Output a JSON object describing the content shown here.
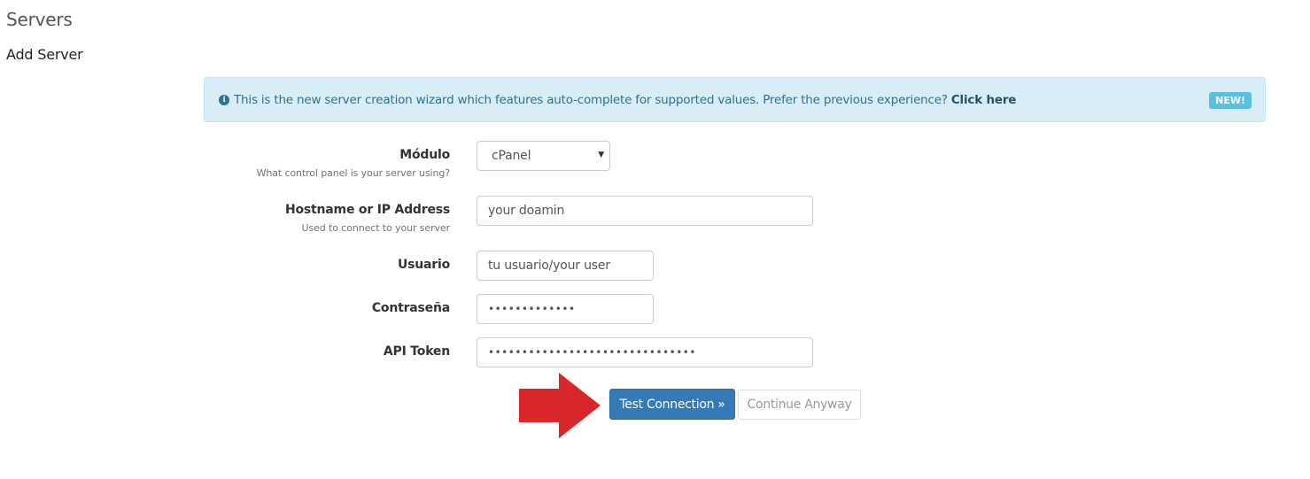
{
  "page": {
    "title": "Servers",
    "subtitle": "Add Server"
  },
  "alert": {
    "icon": "info-circle-icon",
    "message": "This is the new server creation wizard which features auto-complete for supported values. Prefer the previous experience?",
    "link_label": "Click here",
    "badge": "NEW!",
    "colors": {
      "background": "#d9edf7",
      "text": "#31708f",
      "badge": "#5bc0de"
    }
  },
  "form": {
    "module": {
      "label": "Módulo",
      "help": "What control panel is your server using?",
      "selected": "cPanel"
    },
    "hostname": {
      "label": "Hostname or IP Address",
      "help": "Used to connect to your server",
      "value": "your doamin"
    },
    "username": {
      "label": "Usuario",
      "value": "tu usuario/your user"
    },
    "password": {
      "label": "Contraseña",
      "value": "•••••••••••••"
    },
    "api_token": {
      "label": "API Token",
      "value": "•••••••••••••••••••••••••••••••"
    }
  },
  "actions": {
    "test_connection": "Test Connection »",
    "continue_anyway": "Continue Anyway",
    "primary_color": "#337ab7",
    "arrow_color": "#d9262b"
  }
}
